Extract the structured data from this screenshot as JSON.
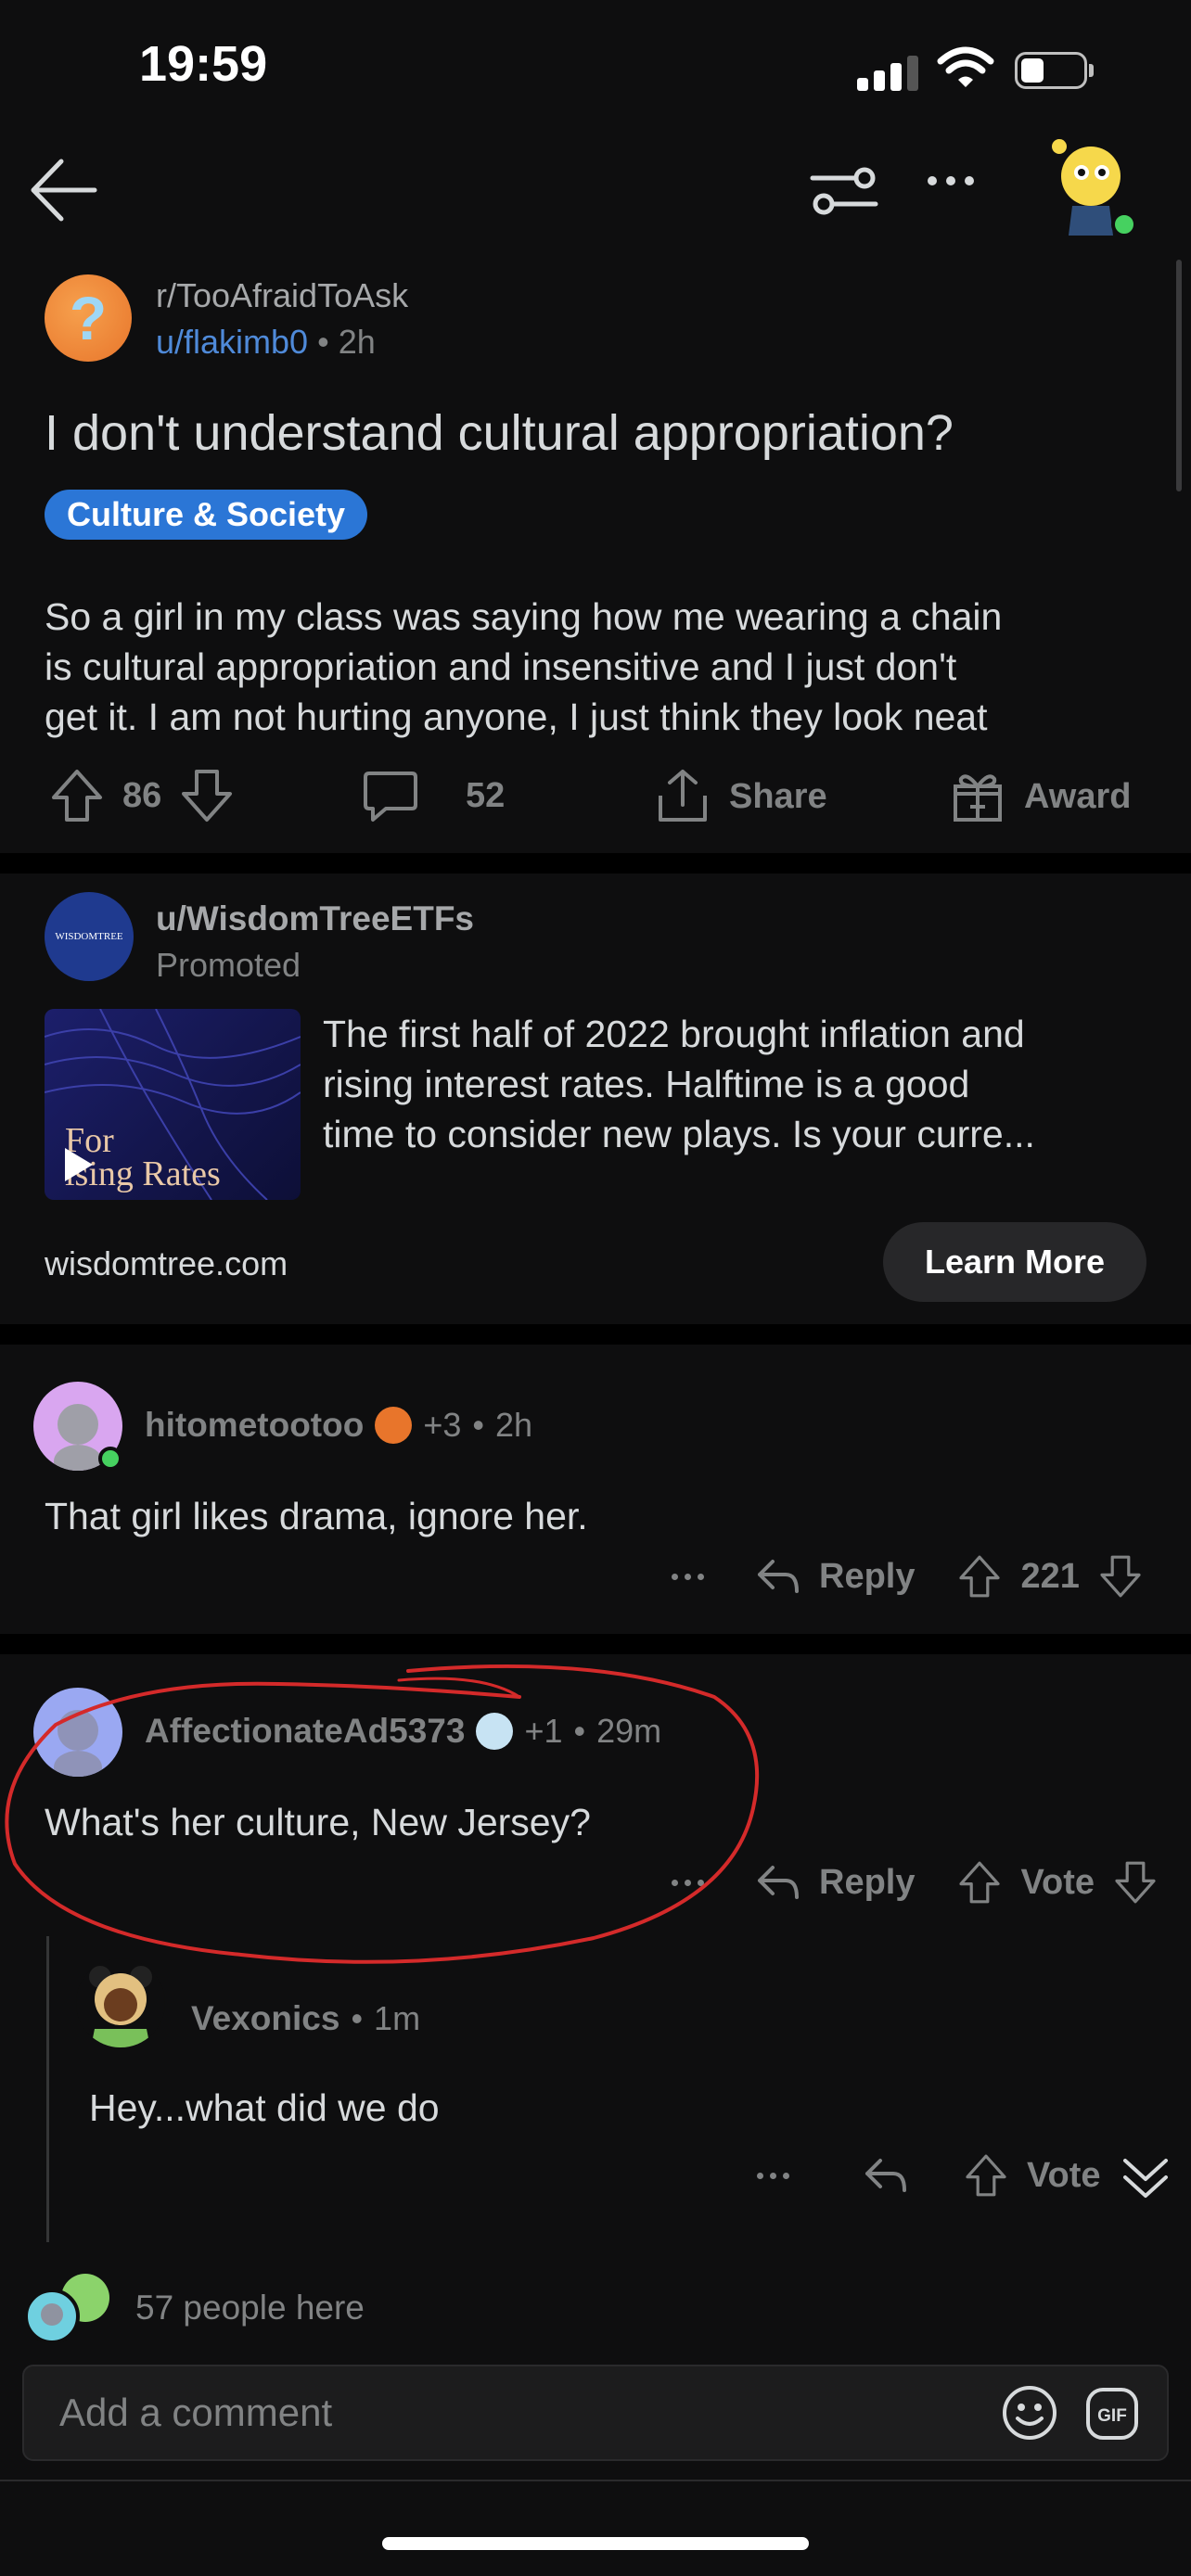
{
  "status_bar": {
    "time": "19:59"
  },
  "post": {
    "subreddit": "r/TooAfraidToAsk",
    "author": "u/flakimb0",
    "age": "2h",
    "title": "I don't understand cultural appropriation?",
    "flair": "Culture & Society",
    "body_lines": [
      "So a girl in my class was saying how me wearing a chain",
      "is cultural appropriation and insensitive and I just don't",
      "get it. I am not hurting anyone, I just think they look neat"
    ],
    "upvotes": "86",
    "comments": "52",
    "share_label": "Share",
    "award_label": "Award"
  },
  "ad": {
    "user": "u/WisdomTreeETFs",
    "promoted": "Promoted",
    "logo_text": "WISDOMTREE",
    "thumb_line1": "For",
    "thumb_line2": "ising Rates",
    "text_lines": [
      "The first half of 2022 brought inflation and",
      "rising interest rates. Halftime is a good",
      "time to consider new plays. Is your curre..."
    ],
    "domain": "wisdomtree.com",
    "cta": "Learn More"
  },
  "comments": [
    {
      "user": "hitometootoo",
      "karma": "+3",
      "age": "2h",
      "body": "That girl likes drama, ignore her.",
      "reply_label": "Reply",
      "votes": "221"
    },
    {
      "user": "AffectionateAd5373",
      "karma": "+1",
      "age": "29m",
      "body": "What's her culture, New Jersey?",
      "reply_label": "Reply",
      "votes": "Vote"
    },
    {
      "user": "Vexonics",
      "age": "1m",
      "body": "Hey...what did we do",
      "votes": "Vote"
    }
  ],
  "footer": {
    "people_here": "57 people here",
    "comment_placeholder": "Add a comment"
  },
  "colors": {
    "background": "#0e0e0f",
    "flair": "#2b76d6",
    "author_link": "#4f8ad9",
    "online": "#46d160",
    "annotation": "#d42a2a"
  }
}
